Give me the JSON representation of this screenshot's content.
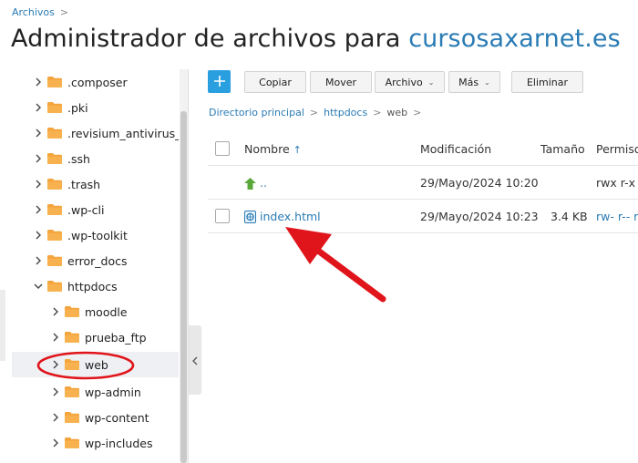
{
  "breadcrumb_top": {
    "label": "Archivos",
    "separator": ">"
  },
  "header": {
    "title_prefix": "Administrador de archivos para ",
    "domain": "cursosaxarnet.es"
  },
  "toolbar": {
    "copy": "Copiar",
    "move": "Mover",
    "file": "Archivo",
    "more": "Más",
    "delete": "Eliminar",
    "caret": "⌄"
  },
  "path": {
    "items": [
      "Directorio principal",
      "httpdocs",
      "web"
    ],
    "separator": ">"
  },
  "table": {
    "headers": {
      "name": "Nombre",
      "sort_arrow": "↑",
      "modified": "Modificación",
      "size": "Tamaño",
      "permissions": "Permiso"
    },
    "rows": [
      {
        "name": "..",
        "modified": "29/Mayo/2024 10:20",
        "size": "",
        "permissions": "rwx r-x -"
      },
      {
        "name": "index.html",
        "modified": "29/Mayo/2024 10:23",
        "size": "3.4 KB",
        "permissions": "rw- r-- r"
      }
    ]
  },
  "tree": {
    "items": [
      {
        "label": ".composer",
        "level": 0,
        "expanded": false
      },
      {
        "label": ".pki",
        "level": 0,
        "expanded": false
      },
      {
        "label": ".revisium_antivirus_ca",
        "level": 0,
        "expanded": false
      },
      {
        "label": ".ssh",
        "level": 0,
        "expanded": false
      },
      {
        "label": ".trash",
        "level": 0,
        "expanded": false
      },
      {
        "label": ".wp-cli",
        "level": 0,
        "expanded": false
      },
      {
        "label": ".wp-toolkit",
        "level": 0,
        "expanded": false
      },
      {
        "label": "error_docs",
        "level": 0,
        "expanded": false
      },
      {
        "label": "httpdocs",
        "level": 0,
        "expanded": true
      },
      {
        "label": "moodle",
        "level": 1,
        "expanded": false
      },
      {
        "label": "prueba_ftp",
        "level": 1,
        "expanded": false
      },
      {
        "label": "web",
        "level": 1,
        "expanded": false,
        "selected": true
      },
      {
        "label": "wp-admin",
        "level": 1,
        "expanded": false
      },
      {
        "label": "wp-content",
        "level": 1,
        "expanded": false
      },
      {
        "label": "wp-includes",
        "level": 1,
        "expanded": false
      }
    ]
  },
  "colors": {
    "accent": "#2a7bb4",
    "add_button": "#2a9fe0",
    "folder": "#f4a43c",
    "annotation": "#e0141b",
    "up_arrow": "#5aa83a"
  }
}
